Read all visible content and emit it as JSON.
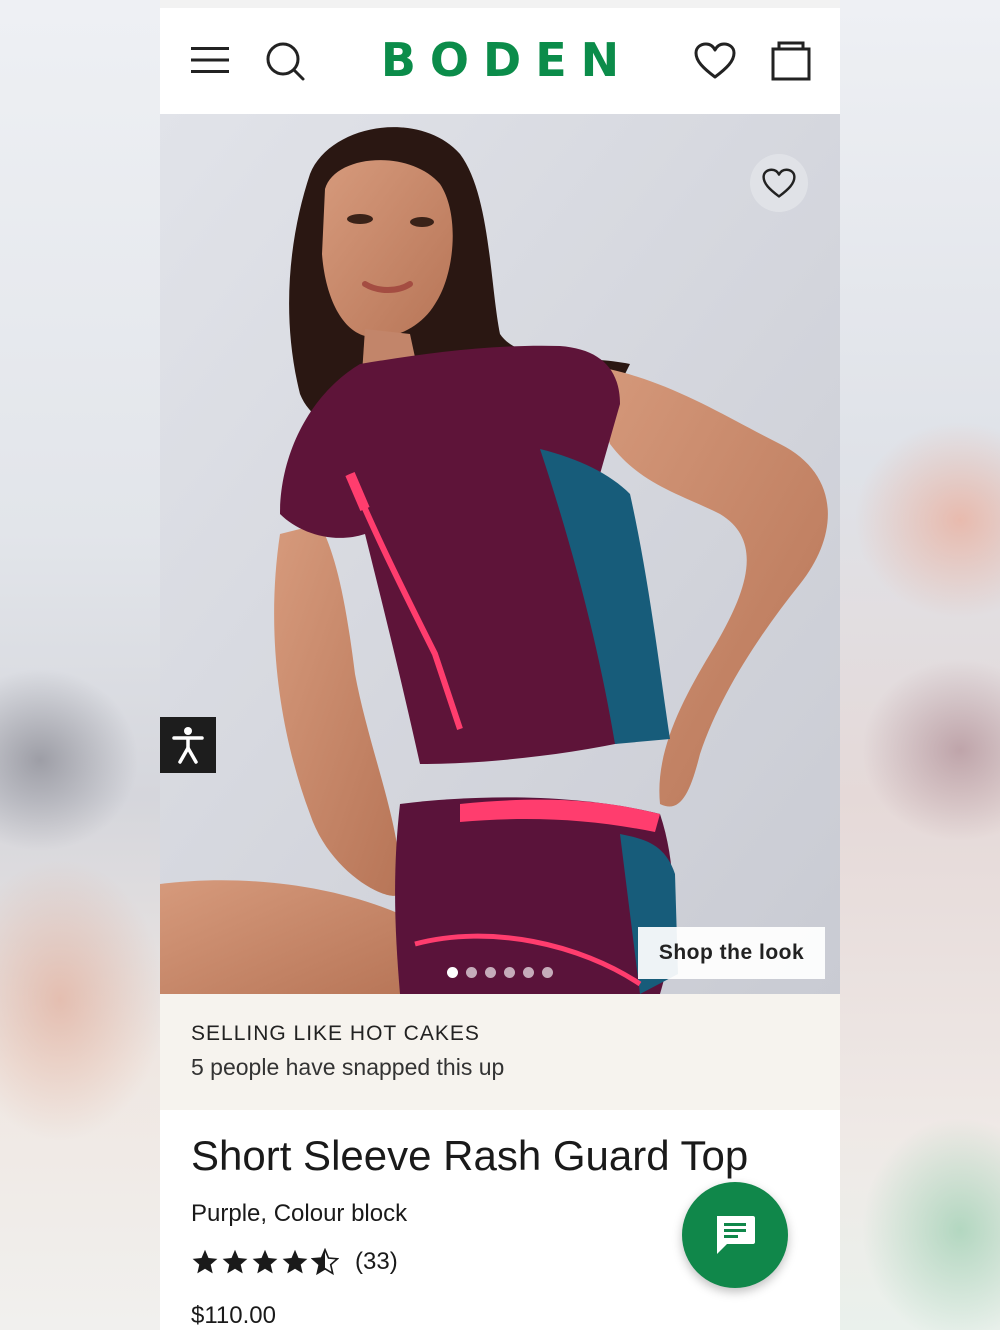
{
  "header": {
    "logo_text": "BODEN",
    "brand_color": "#0b8c4a",
    "icons": [
      "menu-icon",
      "search-icon",
      "heart-icon",
      "bag-icon"
    ]
  },
  "hero": {
    "shop_the_look_label": "Shop the look",
    "carousel_total": 6,
    "carousel_active_index": 0
  },
  "banner": {
    "title": "SELLING LIKE HOT CAKES",
    "subtitle": "5 people have snapped this up"
  },
  "product": {
    "title": "Short Sleeve Rash Guard Top",
    "colour": "Purple, Colour block",
    "rating": 4.5,
    "rating_max": 5,
    "review_count": "(33)",
    "price": "$110.00"
  },
  "chat": {
    "icon": "chat-icon",
    "color": "#10874a"
  }
}
